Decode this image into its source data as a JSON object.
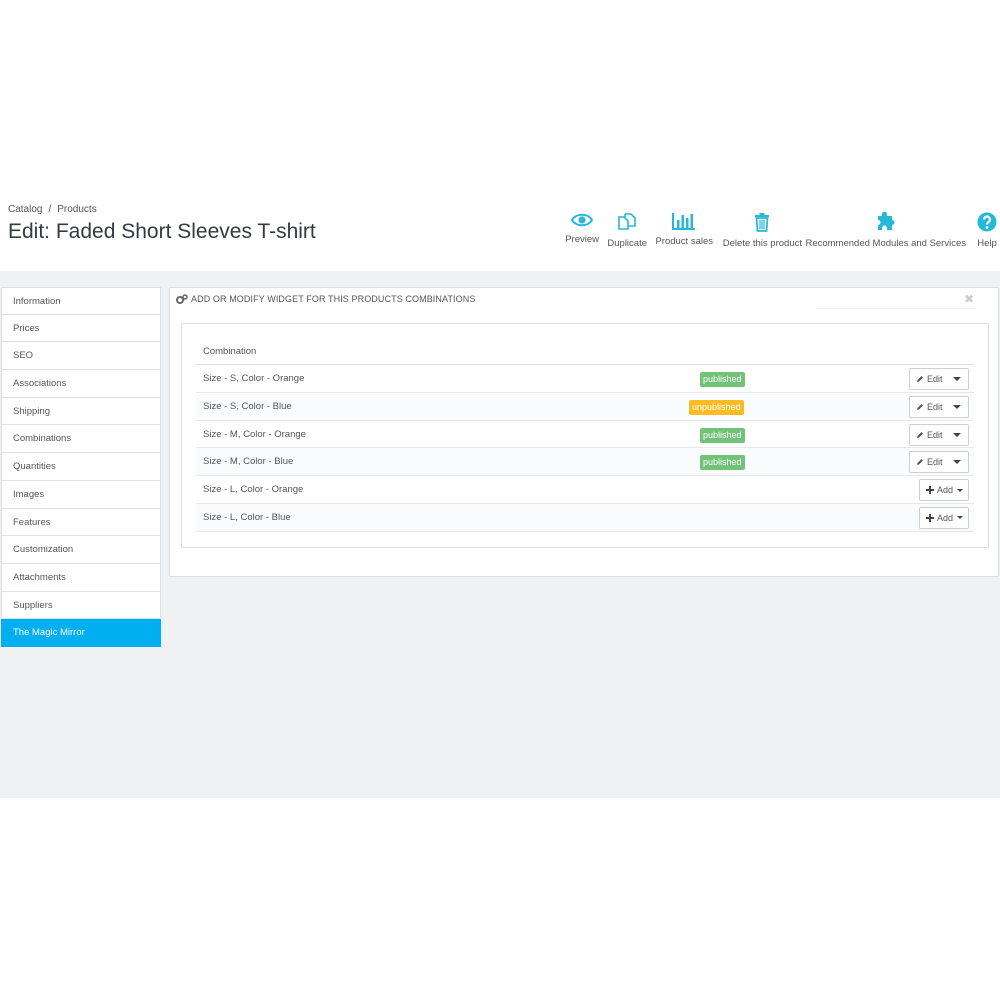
{
  "breadcrumb": [
    "Catalog",
    "Products"
  ],
  "breadcrumb_sep": "/",
  "page_title": "Edit: Faded Short Sleeves T-shirt",
  "toolbar": [
    {
      "label": "Preview",
      "icon": "eye-icon"
    },
    {
      "label": "Duplicate",
      "icon": "copy-icon"
    },
    {
      "label": "Product sales",
      "icon": "bar-chart-icon"
    },
    {
      "label": "Delete this product",
      "icon": "trash-icon"
    },
    {
      "label": "Recommended Modules and Services",
      "icon": "puzzle-icon"
    },
    {
      "label": "Help",
      "icon": "help-icon"
    }
  ],
  "toolbar_color": "#25b9d7",
  "tabs": [
    {
      "label": "Information"
    },
    {
      "label": "Prices"
    },
    {
      "label": "SEO"
    },
    {
      "label": "Associations"
    },
    {
      "label": "Shipping"
    },
    {
      "label": "Combinations"
    },
    {
      "label": "Quantities"
    },
    {
      "label": "Images"
    },
    {
      "label": "Features"
    },
    {
      "label": "Customization"
    },
    {
      "label": "Attachments"
    },
    {
      "label": "Suppliers"
    },
    {
      "label": "The Magic Mirror",
      "active": true
    }
  ],
  "panel": {
    "heading": "ADD OR MODIFY WIDGET FOR THIS PRODUCTS COMBINATIONS",
    "close_glyph": "✖",
    "column_header": "Combination",
    "rows": [
      {
        "name": "Size - S, Color - Orange",
        "status": "published",
        "action": "Edit"
      },
      {
        "name": "Size - S, Color - Blue",
        "status": "unpublished",
        "action": "Edit"
      },
      {
        "name": "Size - M, Color - Orange",
        "status": "published",
        "action": "Edit"
      },
      {
        "name": "Size - M, Color - Blue",
        "status": "published",
        "action": "Edit"
      },
      {
        "name": "Size - L, Color - Orange",
        "status": "",
        "action": "Add"
      },
      {
        "name": "Size - L, Color - Blue",
        "status": "",
        "action": "Add"
      }
    ]
  },
  "colors": {
    "accent": "#00aff0",
    "published": "#72c279",
    "unpublished": "#fbbb22"
  }
}
